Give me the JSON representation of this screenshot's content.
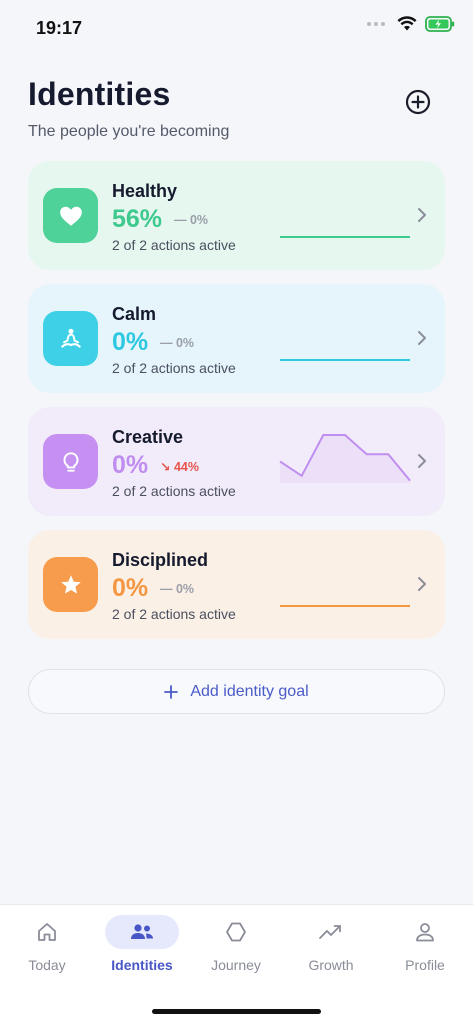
{
  "status": {
    "time": "19:17"
  },
  "header": {
    "title": "Identities",
    "subtitle": "The people you're becoming"
  },
  "identities": [
    {
      "name": "Healthy",
      "percent": "56%",
      "trend": "— 0%",
      "actions": "2 of 2 actions active",
      "icon": "heart-icon",
      "accent": "#3ec98e",
      "card_bg": "#e6f7ef",
      "icon_bg": "#4fd19a",
      "trend_color": "#9a9ea8",
      "spark": [
        0,
        0,
        0,
        0,
        0,
        0,
        0
      ]
    },
    {
      "name": "Calm",
      "percent": "0%",
      "trend": "— 0%",
      "actions": "2 of 2 actions active",
      "icon": "meditation-icon",
      "accent": "#2ec9e0",
      "card_bg": "#e5f5fb",
      "icon_bg": "#3dd0e6",
      "trend_color": "#9a9ea8",
      "spark": [
        0,
        0,
        0,
        0,
        0,
        0,
        0
      ]
    },
    {
      "name": "Creative",
      "percent": "0%",
      "trend": "↘ 44%",
      "actions": "2 of 2 actions active",
      "icon": "lightbulb-icon",
      "accent": "#c08ef0",
      "card_bg": "#f2ecfa",
      "icon_bg": "#c690f2",
      "trend_color": "#e5534b",
      "spark": [
        0.45,
        0.15,
        1.0,
        1.0,
        0.6,
        0.6,
        0.05
      ]
    },
    {
      "name": "Disciplined",
      "percent": "0%",
      "trend": "— 0%",
      "actions": "2 of 2 actions active",
      "icon": "star-icon",
      "accent": "#f59742",
      "card_bg": "#fbf0e6",
      "icon_bg": "#f79c4c",
      "trend_color": "#9a9ea8",
      "spark": [
        0,
        0,
        0,
        0,
        0,
        0,
        0
      ]
    }
  ],
  "add_goal": {
    "label": "Add identity goal"
  },
  "tabs": [
    {
      "label": "Today",
      "icon": "home-icon",
      "active": false
    },
    {
      "label": "Identities",
      "icon": "people-icon",
      "active": true
    },
    {
      "label": "Journey",
      "icon": "hexagon-icon",
      "active": false
    },
    {
      "label": "Growth",
      "icon": "trend-up-icon",
      "active": false
    },
    {
      "label": "Profile",
      "icon": "user-icon",
      "active": false
    }
  ]
}
